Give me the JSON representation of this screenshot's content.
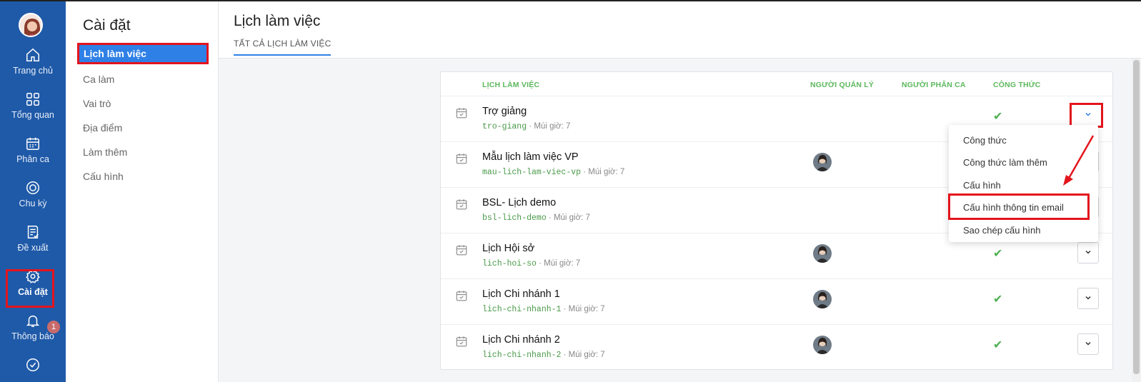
{
  "rail": {
    "items": [
      {
        "label": "Trang chủ",
        "icon": "home-icon"
      },
      {
        "label": "Tổng quan",
        "icon": "grid-icon"
      },
      {
        "label": "Phân ca",
        "icon": "calendar-icon"
      },
      {
        "label": "Chu kỳ",
        "icon": "cycle-icon"
      },
      {
        "label": "Đề xuất",
        "icon": "proposal-icon"
      },
      {
        "label": "Cài đặt",
        "icon": "gear-icon"
      },
      {
        "label": "Thông báo",
        "icon": "bell-icon"
      }
    ],
    "notification_count": "1"
  },
  "settings": {
    "title": "Cài đặt",
    "menu": [
      {
        "label": "Lịch làm việc"
      },
      {
        "label": "Ca làm"
      },
      {
        "label": "Vai trò"
      },
      {
        "label": "Địa điểm"
      },
      {
        "label": "Làm thêm"
      },
      {
        "label": "Cấu hình"
      }
    ]
  },
  "main": {
    "title": "Lịch làm việc",
    "tab": "TẤT CẢ LỊCH LÀM VIỆC"
  },
  "table": {
    "headers": {
      "schedule": "LỊCH LÀM VIỆC",
      "manager": "NGƯỜI QUẢN LÝ",
      "assigner": "NGƯỜI PHÂN CA",
      "formula": "CÔNG THỨC"
    },
    "rows": [
      {
        "name": "Trợ giảng",
        "slug": "tro-giang",
        "tz": " · Múi giờ: 7",
        "has_manager": false,
        "has_formula": true
      },
      {
        "name": "Mẫu lịch làm việc VP",
        "slug": "mau-lich-lam-viec-vp",
        "tz": " · Múi giờ: 7",
        "has_manager": true,
        "has_formula": false
      },
      {
        "name": "BSL- Lịch demo",
        "slug": "bsl-lich-demo",
        "tz": " · Múi giờ: 7",
        "has_manager": false,
        "has_formula": false
      },
      {
        "name": "Lịch Hội sở",
        "slug": "lich-hoi-so",
        "tz": " · Múi giờ: 7",
        "has_manager": true,
        "has_formula": true
      },
      {
        "name": "Lịch Chi nhánh 1",
        "slug": "lich-chi-nhanh-1",
        "tz": " · Múi giờ: 7",
        "has_manager": true,
        "has_formula": true
      },
      {
        "name": "Lịch Chi nhánh 2",
        "slug": "lich-chi-nhanh-2",
        "tz": " · Múi giờ: 7",
        "has_manager": true,
        "has_formula": true
      }
    ]
  },
  "dropdown": {
    "options": [
      {
        "label": "Công thức"
      },
      {
        "label": "Công thức làm thêm"
      },
      {
        "label": "Cấu hình"
      },
      {
        "label": "Cấu hình thông tin email"
      },
      {
        "label": "Sao chép cấu hình"
      }
    ]
  },
  "colors": {
    "rail": "#1f5aa8",
    "accent": "#2f80e6",
    "header_green": "#5cb85c",
    "highlight": "#e3141c"
  }
}
